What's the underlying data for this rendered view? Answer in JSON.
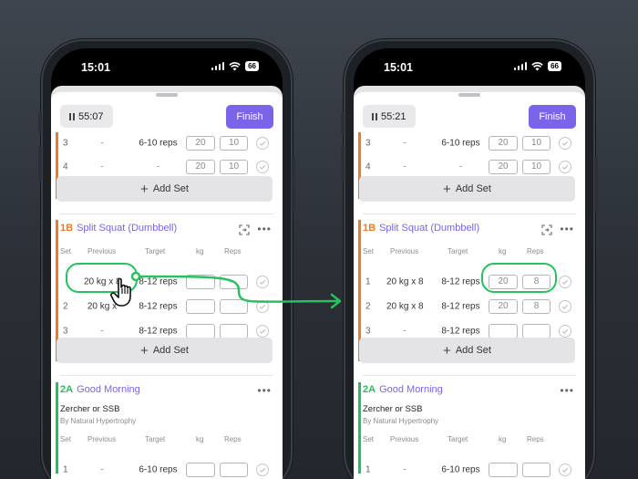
{
  "left": {
    "status": {
      "time": "15:01",
      "battery": "66"
    },
    "timer": "55:07",
    "finish_label": "Finish",
    "top_rows": [
      {
        "set": "3",
        "previous": "-",
        "target": "6-10 reps",
        "kg": "20",
        "reps": "10"
      },
      {
        "set": "4",
        "previous": "-",
        "target": "-",
        "kg": "20",
        "reps": "10"
      }
    ],
    "add_set": "Add Set",
    "ex1": {
      "code": "1B",
      "name": "Split Squat (Dumbbell)"
    },
    "headers": {
      "set": "Set",
      "previous": "Previous",
      "target": "Target",
      "kg": "kg",
      "reps": "Reps"
    },
    "ex1_rows": [
      {
        "set": "",
        "previous": "20 kg x 8",
        "target": "8-12 reps",
        "kg": "",
        "reps": ""
      },
      {
        "set": "2",
        "previous": "20 kg x",
        "target": "8-12 reps",
        "kg": "",
        "reps": ""
      },
      {
        "set": "3",
        "previous": "-",
        "target": "8-12 reps",
        "kg": "",
        "reps": ""
      }
    ],
    "add_set_2": "Add Set",
    "ex2": {
      "code": "2A",
      "name": "Good Morning",
      "note": "Zercher or SSB",
      "by": "By Natural Hypertrophy"
    },
    "ex2_rows": [
      {
        "set": "1",
        "previous": "-",
        "target": "6-10 reps",
        "kg": "",
        "reps": ""
      }
    ]
  },
  "right": {
    "status": {
      "time": "15:01",
      "battery": "66"
    },
    "timer": "55:21",
    "finish_label": "Finish",
    "top_rows": [
      {
        "set": "3",
        "previous": "-",
        "target": "6-10 reps",
        "kg": "20",
        "reps": "10"
      },
      {
        "set": "4",
        "previous": "-",
        "target": "-",
        "kg": "20",
        "reps": "10"
      }
    ],
    "add_set": "Add Set",
    "ex1": {
      "code": "1B",
      "name": "Split Squat (Dumbbell)"
    },
    "headers": {
      "set": "Set",
      "previous": "Previous",
      "target": "Target",
      "kg": "kg",
      "reps": "Reps"
    },
    "ex1_rows": [
      {
        "set": "1",
        "previous": "20 kg x 8",
        "target": "8-12 reps",
        "kg": "20",
        "reps": "8"
      },
      {
        "set": "2",
        "previous": "20 kg x 8",
        "target": "8-12 reps",
        "kg": "20",
        "reps": "8"
      },
      {
        "set": "3",
        "previous": "-",
        "target": "8-12 reps",
        "kg": "",
        "reps": ""
      }
    ],
    "add_set_2": "Add Set",
    "ex2": {
      "code": "2A",
      "name": "Good Morning",
      "note": "Zercher or SSB",
      "by": "By Natural Hypertrophy"
    },
    "ex2_rows": [
      {
        "set": "1",
        "previous": "-",
        "target": "6-10 reps",
        "kg": "",
        "reps": ""
      }
    ]
  },
  "colors": {
    "accent": "#7b63ea",
    "superset_1": "#f07a22",
    "superset_2": "#21c05c",
    "highlight": "#27c25e"
  },
  "icons": [
    "pause-icon",
    "plus-icon",
    "check-circle-icon",
    "swap-icon",
    "more-icon",
    "hand-cursor-icon",
    "arrow-right-icon"
  ]
}
